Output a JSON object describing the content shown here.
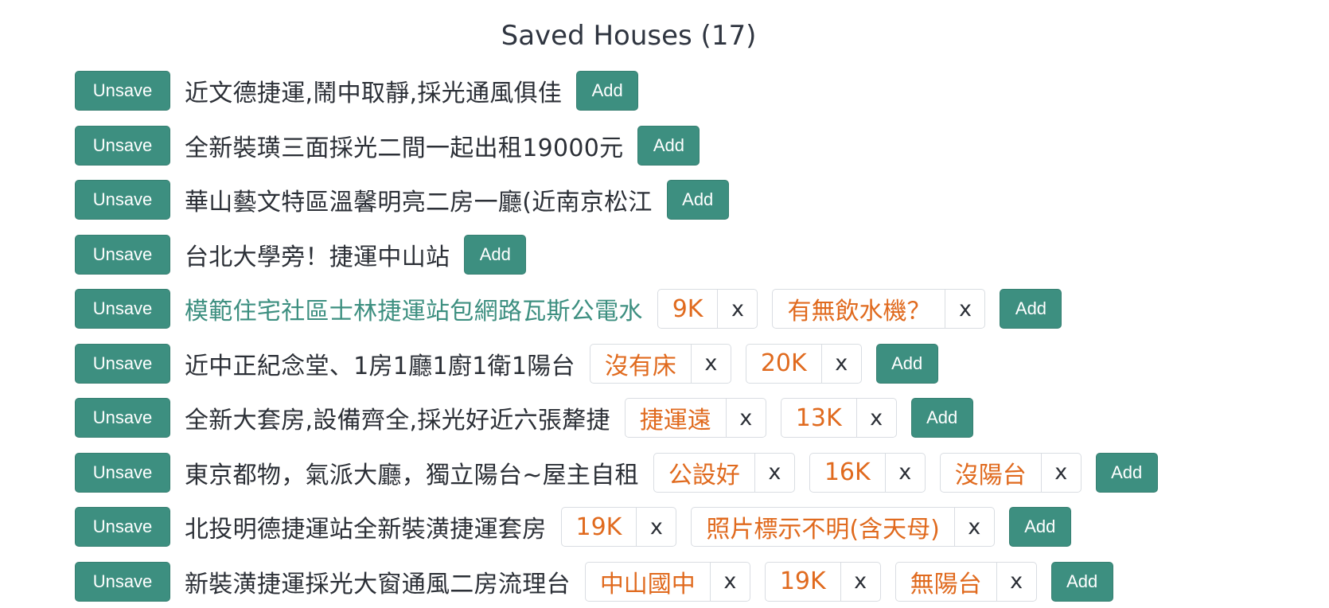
{
  "header": {
    "title": "Saved Houses (17)"
  },
  "labels": {
    "unsave": "Unsave",
    "add": "Add",
    "remove": "x"
  },
  "colors": {
    "primary": "#3d8f80",
    "tag_text": "#e06a1e",
    "text": "#2b2f36"
  },
  "houses": [
    {
      "title": "近文德捷運,鬧中取靜,採光通風俱佳",
      "tags": []
    },
    {
      "title": "全新裝璜三面採光二間一起出租19000元",
      "tags": []
    },
    {
      "title": "華山藝文特區溫馨明亮二房一廳(近南京松江",
      "tags": []
    },
    {
      "title": "台北大學旁！捷運中山站",
      "tags": []
    },
    {
      "title": "模範住宅社區士林捷運站包網路瓦斯公電水",
      "active": true,
      "tags": [
        "9K",
        "有無飲水機？"
      ]
    },
    {
      "title": "近中正紀念堂、1房1廳1廚1衛1陽台",
      "tags": [
        "沒有床",
        "20K"
      ]
    },
    {
      "title": "全新大套房,設備齊全,採光好近六張犛捷",
      "tags": [
        "捷運遠",
        "13K"
      ]
    },
    {
      "title": "東京都物，氣派大廳，獨立陽台~屋主自租",
      "tags": [
        "公設好",
        "16K",
        "沒陽台"
      ]
    },
    {
      "title": "北投明德捷運站全新裝潢捷運套房",
      "tags": [
        "19K",
        "照片標示不明(含天母)"
      ]
    },
    {
      "title": "新裝潢捷運採光大窗通風二房流理台",
      "tags": [
        "中山國中",
        "19K",
        "無陽台"
      ]
    }
  ]
}
